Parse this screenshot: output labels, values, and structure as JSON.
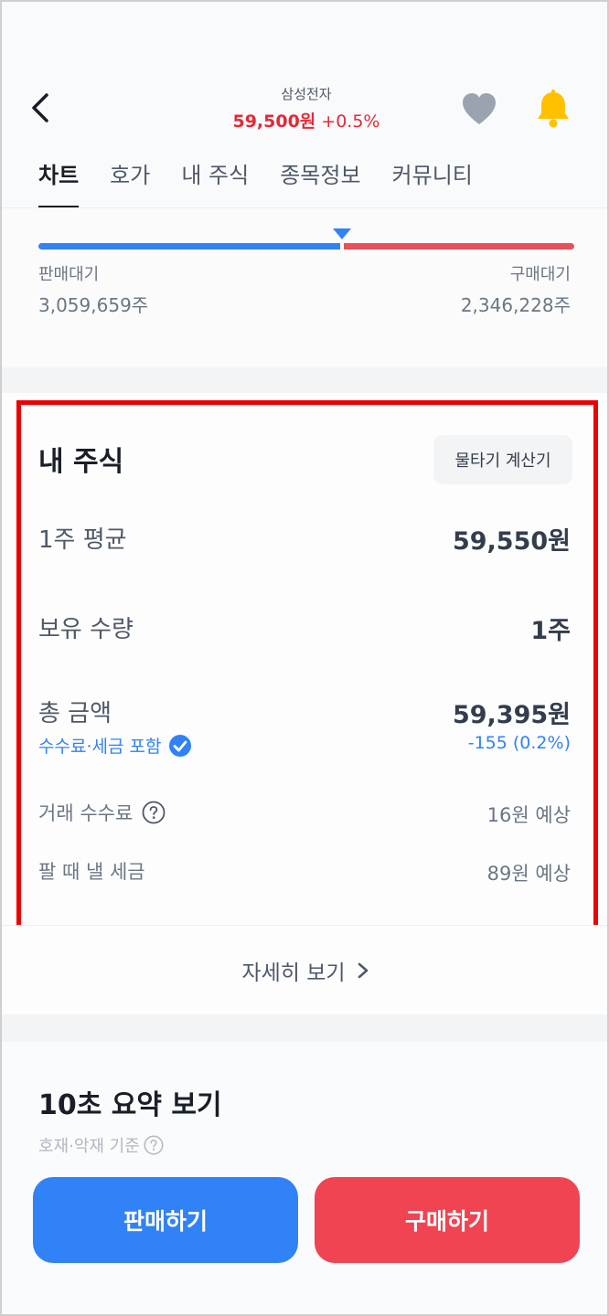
{
  "header": {
    "stock_name": "삼성전자",
    "price": "59,500원",
    "change": "+0.5%"
  },
  "tabs": [
    {
      "label": "차트"
    },
    {
      "label": "호가"
    },
    {
      "label": "내 주식"
    },
    {
      "label": "종목정보"
    },
    {
      "label": "커뮤니티"
    }
  ],
  "order_book": {
    "sell_label": "판매대기",
    "sell_qty": "3,059,659주",
    "buy_label": "구매대기",
    "buy_qty": "2,346,228주",
    "sell_ratio": 0.566
  },
  "my_stock": {
    "title": "내 주식",
    "calc_button": "물타기 계산기",
    "avg_label": "1주 평균",
    "avg_value": "59,550원",
    "qty_label": "보유 수량",
    "qty_value": "1주",
    "total_label": "총 금액",
    "total_value": "59,395원",
    "fee_note": "수수료·세금 포함",
    "diff": "-155 (0.2%)",
    "fee_label": "거래 수수료",
    "fee_value": "16원 예상",
    "tax_label": "팔 때 낼 세금",
    "tax_value": "89원 예상"
  },
  "detail_link": "자세히 보기",
  "summary": {
    "title": "10초 요약 보기",
    "subtitle": "호재·악재 기준"
  },
  "actions": {
    "sell": "판매하기",
    "buy": "구매하기"
  },
  "colors": {
    "rise": "#e42939",
    "sell_blue": "#3182f6",
    "buy_red": "#f04452",
    "highlight": "#ee0000"
  },
  "icons": [
    "back-arrow-icon",
    "heart-icon",
    "bell-icon",
    "check-badge-icon",
    "question-circle-icon",
    "chevron-right-icon"
  ]
}
